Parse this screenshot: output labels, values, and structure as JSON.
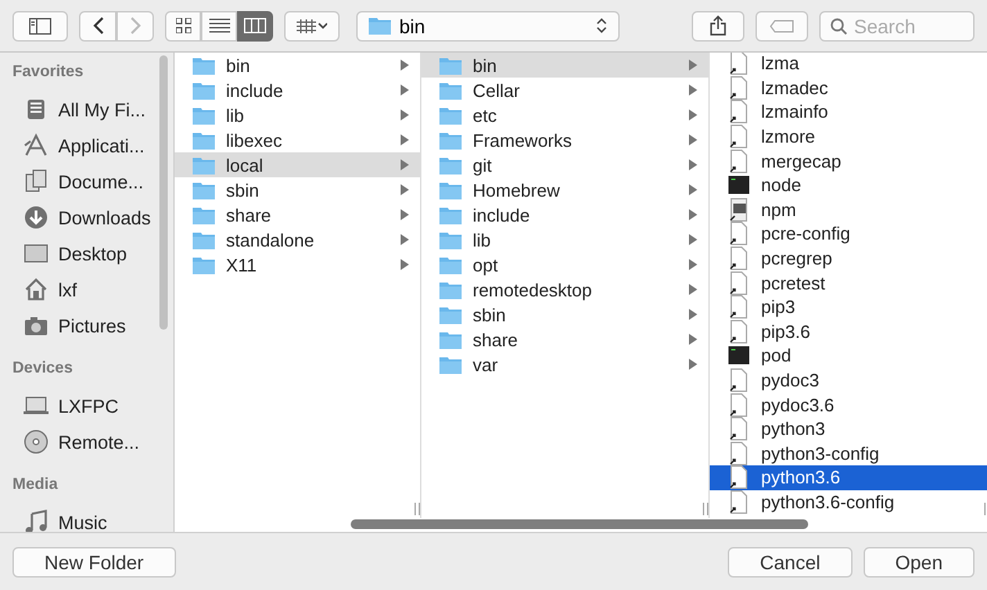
{
  "toolbar": {
    "views": [
      {
        "kind": "icons",
        "selected": false
      },
      {
        "kind": "list",
        "selected": false
      },
      {
        "kind": "columns",
        "selected": true
      }
    ],
    "location": "bin",
    "search": {
      "placeholder": "Search"
    }
  },
  "sidebar": {
    "sections": [
      {
        "title": "Favorites",
        "items": [
          {
            "label": "All My Fi...",
            "kind": "files"
          },
          {
            "label": "Applicati...",
            "kind": "apps"
          },
          {
            "label": "Docume...",
            "kind": "docs"
          },
          {
            "label": "Downloads",
            "kind": "download"
          },
          {
            "label": "Desktop",
            "kind": "desktop"
          },
          {
            "label": "lxf",
            "kind": "home"
          },
          {
            "label": "Pictures",
            "kind": "camera"
          }
        ]
      },
      {
        "title": "Devices",
        "items": [
          {
            "label": "LXFPC",
            "kind": "laptop"
          },
          {
            "label": "Remote...",
            "kind": "disc"
          }
        ]
      },
      {
        "title": "Media",
        "items": [
          {
            "label": "Music",
            "kind": "music"
          }
        ]
      }
    ]
  },
  "columns": [
    {
      "focused": false,
      "items": [
        {
          "name": "bin",
          "kind": "folder",
          "selected": false
        },
        {
          "name": "include",
          "kind": "folder",
          "selected": false
        },
        {
          "name": "lib",
          "kind": "folder",
          "selected": false
        },
        {
          "name": "libexec",
          "kind": "folder",
          "selected": false
        },
        {
          "name": "local",
          "kind": "folder",
          "selected": true
        },
        {
          "name": "sbin",
          "kind": "folder",
          "selected": false
        },
        {
          "name": "share",
          "kind": "folder",
          "selected": false
        },
        {
          "name": "standalone",
          "kind": "folder",
          "selected": false
        },
        {
          "name": "X11",
          "kind": "folder",
          "selected": false
        }
      ]
    },
    {
      "focused": false,
      "items": [
        {
          "name": "bin",
          "kind": "folder",
          "selected": true
        },
        {
          "name": "Cellar",
          "kind": "folder",
          "selected": false
        },
        {
          "name": "etc",
          "kind": "folder",
          "selected": false
        },
        {
          "name": "Frameworks",
          "kind": "folder",
          "selected": false
        },
        {
          "name": "git",
          "kind": "folder",
          "selected": false
        },
        {
          "name": "Homebrew",
          "kind": "folder",
          "selected": false
        },
        {
          "name": "include",
          "kind": "folder",
          "selected": false
        },
        {
          "name": "lib",
          "kind": "folder",
          "selected": false
        },
        {
          "name": "opt",
          "kind": "folder",
          "selected": false
        },
        {
          "name": "remotedesktop",
          "kind": "folder",
          "selected": false
        },
        {
          "name": "sbin",
          "kind": "folder",
          "selected": false
        },
        {
          "name": "share",
          "kind": "folder",
          "selected": false
        },
        {
          "name": "var",
          "kind": "folder",
          "selected": false
        }
      ]
    },
    {
      "focused": true,
      "items": [
        {
          "name": "lzma",
          "kind": "alias",
          "selected": false
        },
        {
          "name": "lzmadec",
          "kind": "alias",
          "selected": false
        },
        {
          "name": "lzmainfo",
          "kind": "alias",
          "selected": false
        },
        {
          "name": "lzmore",
          "kind": "alias",
          "selected": false
        },
        {
          "name": "mergecap",
          "kind": "alias",
          "selected": false
        },
        {
          "name": "node",
          "kind": "exec",
          "selected": false
        },
        {
          "name": "npm",
          "kind": "script",
          "selected": false
        },
        {
          "name": "pcre-config",
          "kind": "alias",
          "selected": false
        },
        {
          "name": "pcregrep",
          "kind": "alias",
          "selected": false
        },
        {
          "name": "pcretest",
          "kind": "alias",
          "selected": false
        },
        {
          "name": "pip3",
          "kind": "alias",
          "selected": false
        },
        {
          "name": "pip3.6",
          "kind": "alias",
          "selected": false
        },
        {
          "name": "pod",
          "kind": "exec",
          "selected": false
        },
        {
          "name": "pydoc3",
          "kind": "alias",
          "selected": false
        },
        {
          "name": "pydoc3.6",
          "kind": "alias",
          "selected": false
        },
        {
          "name": "python3",
          "kind": "alias",
          "selected": false
        },
        {
          "name": "python3-config",
          "kind": "alias",
          "selected": false
        },
        {
          "name": "python3.6",
          "kind": "alias",
          "selected": true
        },
        {
          "name": "python3.6-config",
          "kind": "alias",
          "selected": false
        }
      ]
    }
  ],
  "buttons": {
    "left": [
      "New Folder"
    ],
    "right": [
      "Cancel",
      "Open"
    ]
  }
}
